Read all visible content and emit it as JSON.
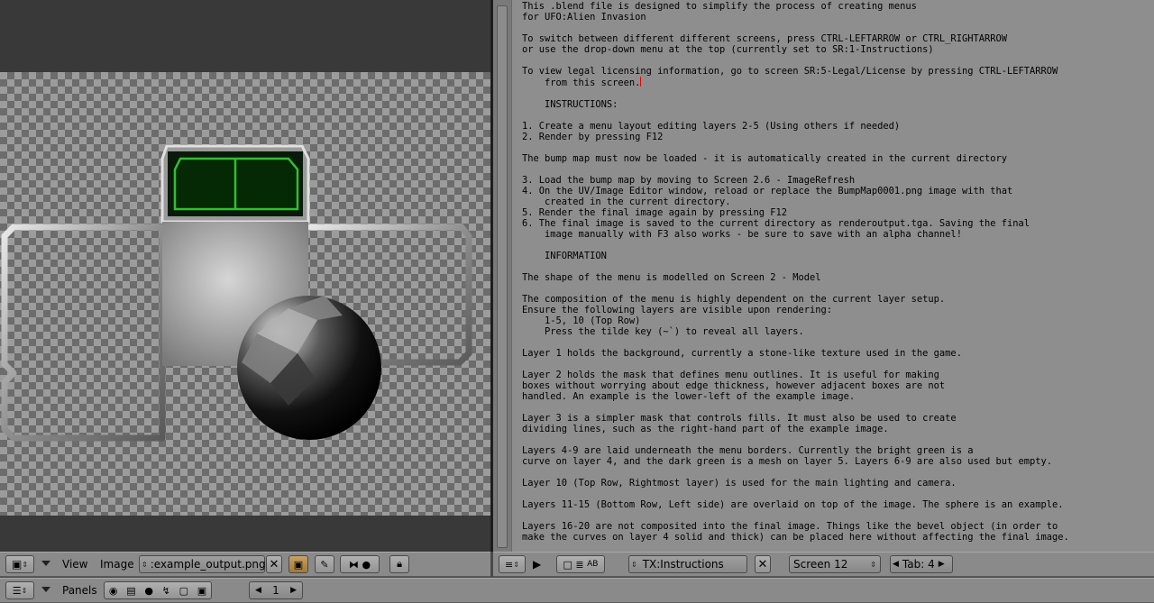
{
  "image_editor": {
    "header": {
      "view_menu": "View",
      "image_menu": "Image",
      "image_name": ":example_output.png"
    }
  },
  "text_editor": {
    "lines": [
      "This .blend file is designed to simplify the process of creating menus",
      "for UFO:Alien Invasion",
      "",
      "To switch between different different screens, press CTRL-LEFTARROW or CTRL_RIGHTARROW",
      "or use the drop-down menu at the top (currently set to SR:1-Instructions)",
      "",
      "To view legal licensing information, go to screen SR:5-Legal/License by pressing CTRL-LEFTARROW",
      "    from this screen.",
      "",
      "    INSTRUCTIONS:",
      "",
      "1. Create a menu layout editing layers 2-5 (Using others if needed)",
      "2. Render by pressing F12",
      "",
      "The bump map must now be loaded - it is automatically created in the current directory",
      "",
      "3. Load the bump map by moving to Screen 2.6 - ImageRefresh",
      "4. On the UV/Image Editor window, reload or replace the BumpMap0001.png image with that",
      "    created in the current directory.",
      "5. Render the final image again by pressing F12",
      "6. The final image is saved to the current directory as renderoutput.tga. Saving the final",
      "    image manually with F3 also works - be sure to save with an alpha channel!",
      "",
      "    INFORMATION",
      "",
      "The shape of the menu is modelled on Screen 2 - Model",
      "",
      "The composition of the menu is highly dependent on the current layer setup.",
      "Ensure the following layers are visible upon rendering:",
      "    1-5, 10 (Top Row)",
      "    Press the tilde key (~`) to reveal all layers.",
      "",
      "Layer 1 holds the background, currently a stone-like texture used in the game.",
      "",
      "Layer 2 holds the mask that defines menu outlines. It is useful for making",
      "boxes without worrying about edge thickness, however adjacent boxes are not",
      "handled. An example is the lower-left of the example image.",
      "",
      "Layer 3 is a simpler mask that controls fills. It must also be used to create",
      "dividing lines, such as the right-hand part of the example image.",
      "",
      "Layers 4-9 are laid underneath the menu borders. Currently the bright green is a",
      "curve on layer 4, and the dark green is a mesh on layer 5. Layers 6-9 are also used but empty.",
      "",
      "Layer 10 (Top Row, Rightmost layer) is used for the main lighting and camera.",
      "",
      "Layers 11-15 (Bottom Row, Left side) are overlaid on top of the image. The sphere is an example.",
      "",
      "Layers 16-20 are not composited into the final image. Things like the bevel object (in order to",
      "make the curves on layer 4 solid and thick) can be placed here without affecting the final image."
    ],
    "header": {
      "text_name": "TX:Instructions",
      "screen_name": "Screen 12",
      "tab_label": "Tab: 4"
    }
  },
  "bottom_bar": {
    "panels_menu": "Panels",
    "frame_value": "1"
  },
  "colors": {
    "text_bg": "#8e8e8e",
    "header_bg": "#8a8a8a",
    "green_outline": "#2fc02f",
    "caret": "#e00000"
  }
}
